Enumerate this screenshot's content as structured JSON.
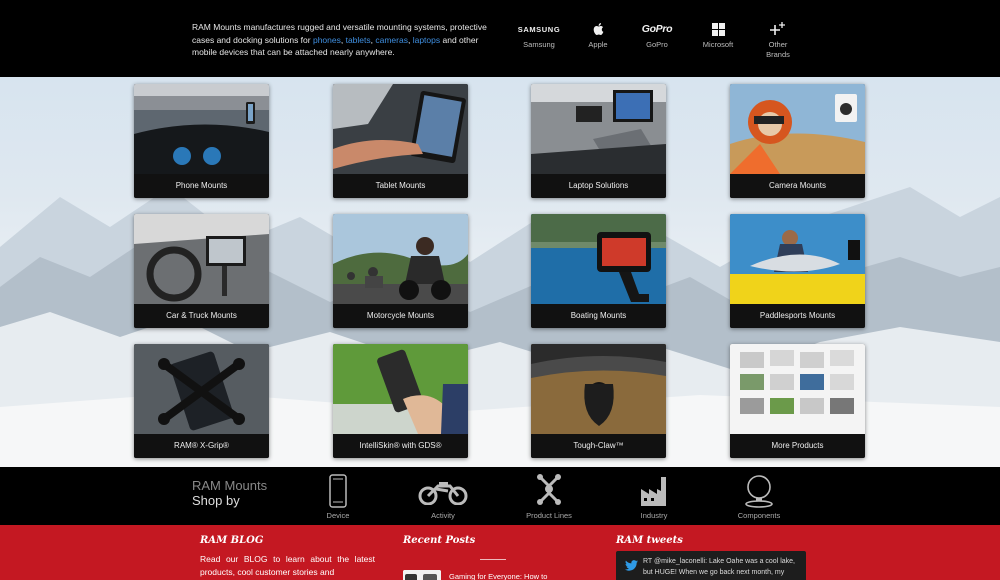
{
  "intro": {
    "before": "RAM Mounts manufactures rugged and versatile mounting systems, protective cases and docking solutions for ",
    "link_phones": "phones",
    "sep1": ", ",
    "link_tablets": "tablets",
    "sep2": ", ",
    "link_cameras": "cameras",
    "sep3": ", ",
    "link_laptops": "laptops",
    "after": " and other mobile devices that can be attached nearly anywhere."
  },
  "brands": {
    "samsung_wordmark": "SAMSUNG",
    "samsung": "Samsung",
    "apple": "Apple",
    "gopro_wordmark": "GoPro",
    "gopro": "GoPro",
    "microsoft": "Microsoft",
    "other_line1": "Other",
    "other_line2": "Brands"
  },
  "categories": [
    "Phone Mounts",
    "Tablet Mounts",
    "Laptop Solutions",
    "Camera Mounts",
    "Car & Truck Mounts",
    "Motorcycle Mounts",
    "Boating Mounts",
    "Paddlesports Mounts",
    "RAM® X-Grip®",
    "IntelliSkin® with GDS®",
    "Tough-Claw™",
    "More Products"
  ],
  "shop": {
    "title_line1": "RAM Mounts",
    "title_line2": "Shop by",
    "items": [
      "Device",
      "Activity",
      "Product Lines",
      "Industry",
      "Components"
    ]
  },
  "footer": {
    "blog_title": "RAM BLOG",
    "blog_text": "Read our BLOG to learn about the latest products, cool customer stories and",
    "posts_title": "Recent Posts",
    "post_title": "Gaming for Everyone: How to",
    "tweets_title": "RAM tweets",
    "tweet_text": "RT @mike_laconelli: Lake Oahe was a cool lake, but HUGE! When we go back next month, my"
  },
  "colors": {
    "topbar": "#000000",
    "footer_red": "#c41822",
    "link_blue": "#3f8fe0",
    "caption_bar": "#111111"
  },
  "icons": {
    "brands": [
      "samsung-icon",
      "apple-icon",
      "gopro-icon",
      "microsoft-icon",
      "plus-icon"
    ],
    "shop": [
      "smartphone-icon",
      "motorcycle-icon",
      "product-lines-icon",
      "factory-icon",
      "ball-mount-icon"
    ],
    "tweet": "twitter-bird-icon"
  }
}
